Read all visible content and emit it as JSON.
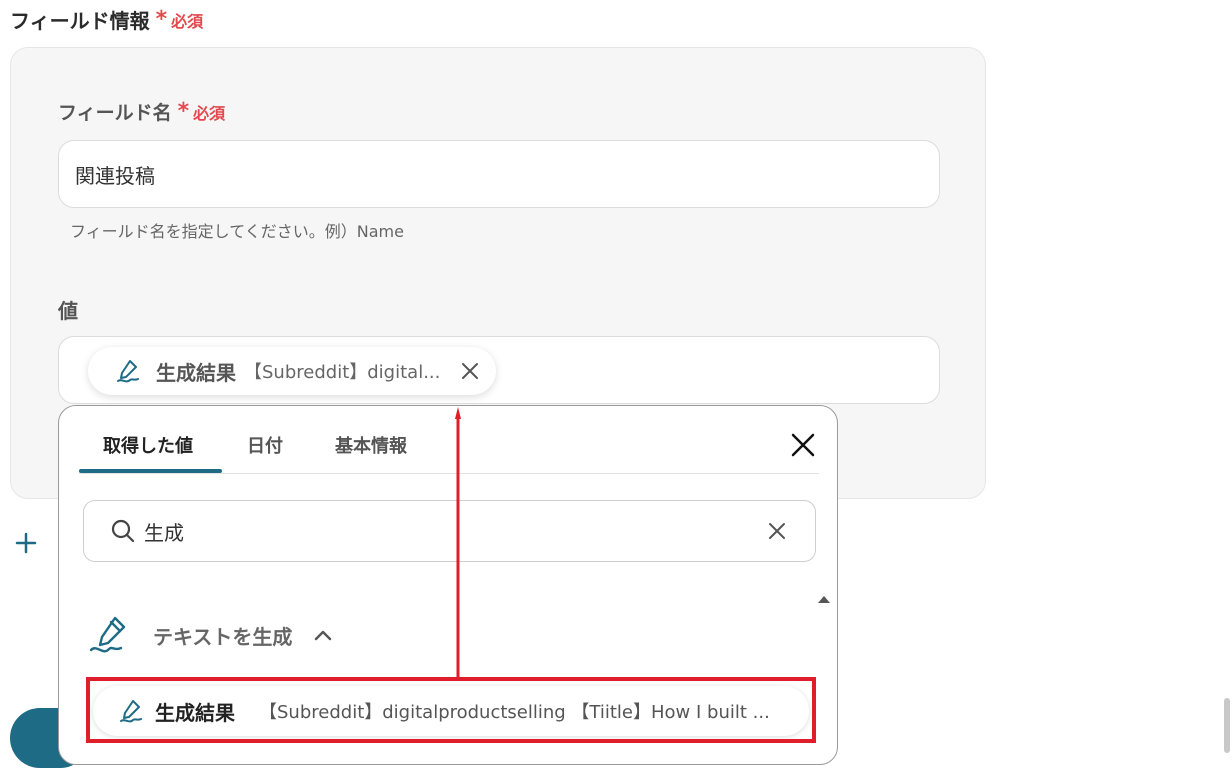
{
  "section": {
    "title": "フィールド情報",
    "required_mark": "*",
    "required_text": "必須"
  },
  "field_name": {
    "label": "フィールド名",
    "required_mark": "*",
    "required_text": "必須",
    "value": "関連投稿",
    "help": "フィールド名を指定してください。例）Name"
  },
  "value_field": {
    "label": "値",
    "chip": {
      "icon": "pen-icon",
      "title": "生成結果",
      "subtitle": "【Subreddit】digital..."
    }
  },
  "panel": {
    "tabs": [
      {
        "label": "取得した値",
        "active": true
      },
      {
        "label": "日付",
        "active": false
      },
      {
        "label": "基本情報",
        "active": false
      }
    ],
    "search": {
      "value": "生成"
    },
    "group": {
      "label": "テキストを生成",
      "icon": "pen-icon",
      "expanded": true
    },
    "items": [
      {
        "title": "生成結果",
        "subtitle": "【Subreddit】digitalproductselling 【Tiitle】How I built ..."
      }
    ]
  },
  "colors": {
    "accent": "#1e6b86",
    "required": "#e5484d",
    "annotation": "#e01e2b"
  }
}
